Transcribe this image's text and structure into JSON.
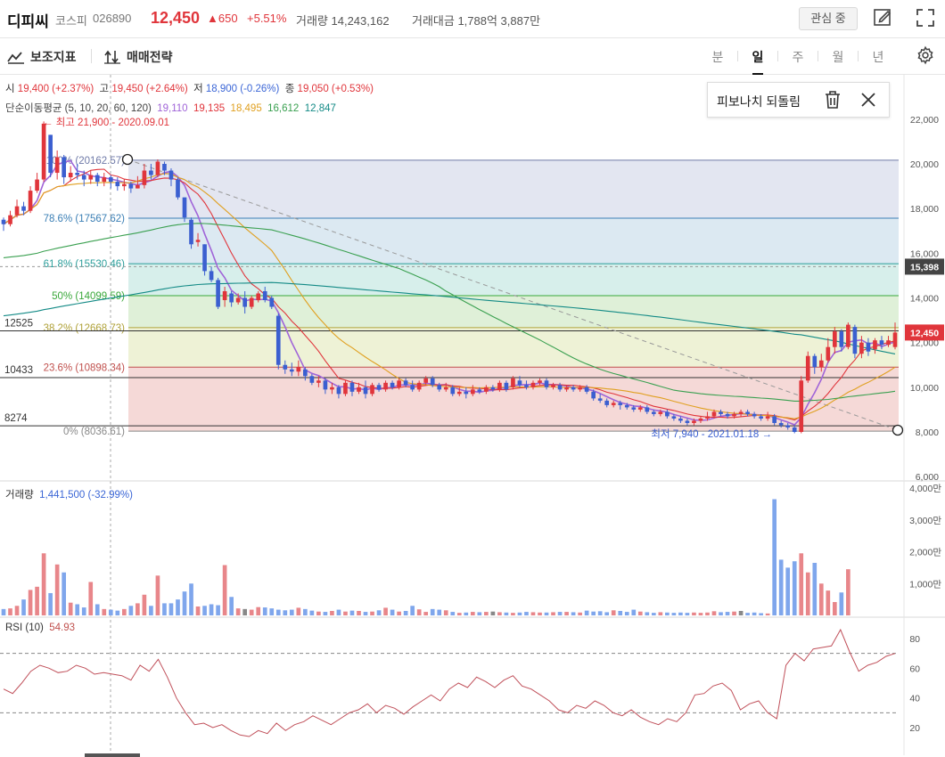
{
  "header": {
    "name": "디피씨",
    "market": "코스피",
    "code": "026890",
    "price": "12,450",
    "change": "▲650",
    "change_pct": "+5.51%",
    "volume_label": "거래량 14,243,162",
    "amount_label": "거래대금 1,788억 3,887만",
    "watch_label": "관심 중"
  },
  "toolbar": {
    "indicators_label": "보조지표",
    "strategy_label": "매매전략",
    "periods": [
      "분",
      "일",
      "주",
      "월",
      "년"
    ],
    "active_period": "일"
  },
  "ohlc": {
    "open_label": "시",
    "open": "19,400 (+2.37%)",
    "high_label": "고",
    "high": "19,450 (+2.64%)",
    "low_label": "저",
    "low": "18,900 (-0.26%)",
    "close_label": "종",
    "close": "19,050 (+0.53%)"
  },
  "ma": {
    "label": "단순이동평균 (5, 10, 20, 60, 120)",
    "values": [
      "19,110",
      "19,135",
      "18,495",
      "16,612",
      "12,847"
    ],
    "colors": [
      "#a064d8",
      "#e0353b",
      "#e0a020",
      "#3aa050",
      "#138a86"
    ]
  },
  "annotations": {
    "high": "← 최고 21,900 - 2020.09.01",
    "low": "최저 7,940 - 2021.01.18 →"
  },
  "fib_panel": {
    "title": "피보나치 되돌림"
  },
  "fib_levels": [
    {
      "label": "100% (20162.57)",
      "value": 20162.57,
      "color": "#6f7aa8",
      "fill": "#e3e6f1"
    },
    {
      "label": "78.6% (17567.62)",
      "value": 17567.62,
      "color": "#3b7fb5",
      "fill": "#dce9f2"
    },
    {
      "label": "61.8% (15530.46)",
      "value": 15530.46,
      "color": "#2a9d9a",
      "fill": "#d7efeb"
    },
    {
      "label": "50% (14099.59)",
      "value": 14099.59,
      "color": "#3aa83a",
      "fill": "#dff0d8"
    },
    {
      "label": "38.2% (12668.73)",
      "value": 12668.73,
      "color": "#b0a23a",
      "fill": "#eef2d6"
    },
    {
      "label": "23.6% (10898.34)",
      "value": 10898.34,
      "color": "#c0504d",
      "fill": "#f5d9d7"
    },
    {
      "label": "0% (8036.61)",
      "value": 8036.61,
      "color": "#888888",
      "fill": "#f5d9d7"
    }
  ],
  "hlines": [
    {
      "label": "12525",
      "value": 12525
    },
    {
      "label": "10433",
      "value": 10433
    },
    {
      "label": "8274",
      "value": 8274
    }
  ],
  "price_axis": {
    "ticks": [
      "22,000",
      "20,000",
      "18,000",
      "16,000",
      "14,000",
      "12,000",
      "10,000",
      "8,000",
      "6,000"
    ],
    "tick_values": [
      22000,
      20000,
      18000,
      16000,
      14000,
      12000,
      10000,
      8000,
      6000
    ],
    "current_tag": "12,450",
    "current_value": 12450,
    "prev_tag": "15,398",
    "prev_value": 15398
  },
  "volume": {
    "label": "거래량",
    "value": "1,441,500 (-32.99%)",
    "ticks": [
      "4,000만",
      "3,000만",
      "2,000만",
      "1,000만"
    ],
    "tick_values": [
      4000,
      3000,
      2000,
      1000
    ]
  },
  "rsi": {
    "label": "RSI (10)",
    "value": "54.93",
    "ticks": [
      "80",
      "60",
      "40",
      "20"
    ],
    "tick_values": [
      80,
      60,
      40,
      20
    ],
    "guides": [
      70,
      30
    ]
  },
  "chart_data": {
    "type": "candlestick",
    "y_range": [
      6000,
      22500
    ],
    "candles": [
      [
        17500,
        17300,
        17600,
        17000
      ],
      [
        17300,
        17700,
        17900,
        17200
      ],
      [
        17700,
        18100,
        18400,
        17600
      ],
      [
        18100,
        17900,
        18300,
        17700
      ],
      [
        17900,
        18800,
        19000,
        17800
      ],
      [
        18800,
        19300,
        19600,
        18700
      ],
      [
        19300,
        21800,
        21900,
        19200
      ],
      [
        21300,
        19600,
        21300,
        19400
      ],
      [
        19600,
        20300,
        20600,
        19300
      ],
      [
        20300,
        19400,
        20400,
        19100
      ],
      [
        19400,
        19600,
        19900,
        19200
      ],
      [
        19600,
        19500,
        20000,
        19300
      ],
      [
        19500,
        19300,
        19700,
        19000
      ],
      [
        19300,
        19500,
        19700,
        19100
      ],
      [
        19500,
        19200,
        19600,
        19000
      ],
      [
        19200,
        19400,
        19600,
        19000
      ],
      [
        19400,
        19200,
        19500,
        18900
      ],
      [
        19200,
        19000,
        19400,
        18800
      ],
      [
        19000,
        19100,
        19300,
        18800
      ],
      [
        19100,
        18900,
        19200,
        18700
      ],
      [
        18900,
        19050,
        19450,
        18900
      ],
      [
        19050,
        19700,
        20000,
        18900
      ],
      [
        19700,
        19500,
        20000,
        19300
      ],
      [
        19500,
        20100,
        20200,
        19400
      ],
      [
        20000,
        19700,
        20100,
        19500
      ],
      [
        19700,
        19300,
        19800,
        19000
      ],
      [
        19300,
        18500,
        19400,
        18400
      ],
      [
        18500,
        17600,
        18500,
        17400
      ],
      [
        17500,
        16400,
        17600,
        16200
      ],
      [
        16500,
        16600,
        16900,
        16300
      ],
      [
        16400,
        15200,
        16400,
        15000
      ],
      [
        15200,
        14800,
        15400,
        14700
      ],
      [
        14800,
        13600,
        14900,
        13500
      ],
      [
        13900,
        14300,
        14500,
        13600
      ],
      [
        14200,
        13800,
        14300,
        13600
      ],
      [
        13800,
        14000,
        14200,
        13700
      ],
      [
        14000,
        13600,
        14300,
        13300
      ],
      [
        13600,
        14000,
        14100,
        13500
      ],
      [
        13900,
        14200,
        14300,
        13800
      ],
      [
        14300,
        13900,
        14500,
        13800
      ],
      [
        14000,
        13600,
        14100,
        13500
      ],
      [
        13200,
        11000,
        13300,
        10800
      ],
      [
        11000,
        10800,
        11200,
        10600
      ],
      [
        10800,
        10700,
        11100,
        10500
      ],
      [
        10700,
        10900,
        11200,
        10500
      ],
      [
        10800,
        10500,
        10900,
        10300
      ],
      [
        10500,
        10200,
        10600,
        10100
      ],
      [
        10200,
        10300,
        10500,
        10000
      ],
      [
        10300,
        9900,
        10400,
        9700
      ],
      [
        9900,
        10000,
        10200,
        9700
      ],
      [
        10000,
        9700,
        10100,
        9500
      ],
      [
        9700,
        10200,
        10300,
        9600
      ],
      [
        10200,
        9800,
        10300,
        9600
      ],
      [
        9800,
        10000,
        10200,
        9700
      ],
      [
        10000,
        9700,
        10300,
        9500
      ],
      [
        9700,
        10100,
        10200,
        9600
      ],
      [
        10100,
        9900,
        10200,
        9800
      ],
      [
        9900,
        10200,
        10300,
        9800
      ],
      [
        10200,
        10000,
        10300,
        9900
      ],
      [
        10000,
        10300,
        10400,
        9900
      ],
      [
        10300,
        10100,
        10400,
        10000
      ],
      [
        10100,
        9900,
        10300,
        9800
      ],
      [
        9900,
        10200,
        10300,
        9800
      ],
      [
        10200,
        10400,
        10500,
        10100
      ],
      [
        10400,
        10100,
        10500,
        10000
      ],
      [
        10100,
        9900,
        10200,
        9800
      ],
      [
        9900,
        10000,
        10200,
        9800
      ],
      [
        10000,
        9700,
        10100,
        9600
      ],
      [
        9700,
        9800,
        10000,
        9600
      ],
      [
        9800,
        9700,
        10000,
        9500
      ],
      [
        9700,
        9900,
        10100,
        9600
      ],
      [
        9900,
        9800,
        10000,
        9700
      ],
      [
        9800,
        10000,
        10100,
        9700
      ],
      [
        10000,
        9900,
        10100,
        9800
      ],
      [
        9900,
        10200,
        10300,
        9800
      ],
      [
        10200,
        9900,
        10300,
        9800
      ],
      [
        10000,
        10400,
        10500,
        9900
      ],
      [
        10300,
        10100,
        10500,
        10000
      ],
      [
        10100,
        10000,
        10300,
        9900
      ],
      [
        10000,
        10200,
        10300,
        9900
      ],
      [
        10200,
        10300,
        10400,
        10100
      ],
      [
        10300,
        10000,
        10400,
        9900
      ],
      [
        10000,
        10100,
        10200,
        9900
      ],
      [
        10100,
        9900,
        10200,
        9800
      ],
      [
        9900,
        10000,
        10100,
        9800
      ],
      [
        10000,
        9900,
        10100,
        9800
      ],
      [
        9900,
        10000,
        10100,
        9800
      ],
      [
        10000,
        9800,
        10100,
        9700
      ],
      [
        9800,
        9500,
        9900,
        9400
      ],
      [
        9500,
        9400,
        9700,
        9300
      ],
      [
        9400,
        9200,
        9500,
        9100
      ],
      [
        9200,
        9300,
        9400,
        9100
      ],
      [
        9300,
        9200,
        9400,
        9000
      ],
      [
        9200,
        9100,
        9300,
        9000
      ],
      [
        9100,
        9000,
        9200,
        8900
      ],
      [
        9000,
        9100,
        9200,
        8900
      ],
      [
        9100,
        8900,
        9200,
        8800
      ],
      [
        8900,
        8800,
        9000,
        8700
      ],
      [
        8800,
        8900,
        9000,
        8700
      ],
      [
        8900,
        8700,
        9000,
        8600
      ],
      [
        8700,
        8600,
        8800,
        8500
      ],
      [
        8600,
        8500,
        8700,
        8400
      ],
      [
        8500,
        8400,
        8600,
        8300
      ],
      [
        8400,
        8500,
        8600,
        8300
      ],
      [
        8500,
        8600,
        8700,
        8400
      ],
      [
        8600,
        8700,
        8900,
        8500
      ],
      [
        8700,
        8900,
        9000,
        8600
      ],
      [
        8900,
        8800,
        9000,
        8700
      ],
      [
        8800,
        8700,
        8900,
        8600
      ],
      [
        8700,
        8800,
        8900,
        8600
      ],
      [
        8800,
        8900,
        9000,
        8700
      ],
      [
        8900,
        8800,
        9000,
        8700
      ],
      [
        8800,
        8700,
        8900,
        8600
      ],
      [
        8700,
        8600,
        8800,
        8500
      ],
      [
        8600,
        8700,
        8900,
        8500
      ],
      [
        8700,
        8400,
        8800,
        8300
      ],
      [
        8400,
        8300,
        8500,
        8200
      ],
      [
        8300,
        8200,
        8400,
        8100
      ],
      [
        8200,
        8000,
        8300,
        7940
      ],
      [
        8000,
        10300,
        10500,
        7940
      ],
      [
        10300,
        11400,
        11600,
        10200
      ],
      [
        11400,
        10900,
        11500,
        10600
      ],
      [
        10900,
        11200,
        11500,
        10700
      ],
      [
        11200,
        11800,
        12200,
        11100
      ],
      [
        11800,
        12500,
        12700,
        11500
      ],
      [
        12500,
        11800,
        12600,
        11600
      ],
      [
        11800,
        12800,
        12900,
        11700
      ],
      [
        12700,
        11500,
        12800,
        11300
      ],
      [
        11500,
        12000,
        12300,
        11300
      ],
      [
        12000,
        11600,
        12200,
        11400
      ],
      [
        11700,
        12100,
        12200,
        11500
      ],
      [
        12100,
        11900,
        12300,
        11700
      ],
      [
        11900,
        12100,
        12300,
        11800
      ],
      [
        11800,
        12450,
        12900,
        11700
      ]
    ],
    "volume": [
      200,
      220,
      300,
      500,
      800,
      900,
      1950,
      700,
      1600,
      1350,
      400,
      350,
      250,
      1050,
      350,
      200,
      180,
      150,
      200,
      300,
      380,
      650,
      300,
      1250,
      380,
      380,
      500,
      750,
      1000,
      280,
      300,
      350,
      320,
      1580,
      580,
      220,
      200,
      180,
      260,
      250,
      220,
      180,
      160,
      180,
      240,
      200,
      150,
      120,
      110,
      140,
      180,
      120,
      150,
      140,
      110,
      120,
      160,
      240,
      180,
      120,
      140,
      300,
      190,
      110,
      200,
      180,
      160,
      110,
      80,
      90,
      110,
      100,
      110,
      120,
      100,
      90,
      80,
      90,
      110,
      100,
      90,
      90,
      100,
      110,
      110,
      100,
      90,
      150,
      120,
      130,
      100,
      160,
      140,
      110,
      180,
      120,
      100,
      80,
      100,
      90,
      80,
      90,
      80,
      90,
      80,
      90,
      130,
      100,
      110,
      120,
      140,
      80,
      90,
      70,
      60,
      3650,
      1750,
      1500,
      1700,
      1950,
      1350,
      1650,
      1000,
      780,
      420,
      720,
      1450
    ],
    "rsi": [
      46,
      43,
      50,
      58,
      62,
      60,
      57,
      58,
      62,
      60,
      56,
      57,
      56,
      55,
      52,
      62,
      58,
      66,
      54,
      40,
      30,
      22,
      23,
      20,
      22,
      18,
      15,
      14,
      18,
      16,
      23,
      18,
      22,
      24,
      28,
      25,
      22,
      26,
      30,
      32,
      36,
      30,
      35,
      33,
      29,
      34,
      38,
      42,
      38,
      46,
      50,
      47,
      54,
      51,
      47,
      52,
      55,
      48,
      46,
      42,
      38,
      32,
      30,
      35,
      33,
      38,
      35,
      30,
      28,
      32,
      27,
      24,
      22,
      26,
      24,
      30,
      42,
      43,
      48,
      50,
      45,
      32,
      36,
      38,
      30,
      26,
      62,
      70,
      65,
      73,
      74,
      75,
      86,
      71,
      58,
      62,
      64,
      68,
      70
    ],
    "x_dates": [
      "2020.09.01",
      "2021.01.18"
    ]
  }
}
